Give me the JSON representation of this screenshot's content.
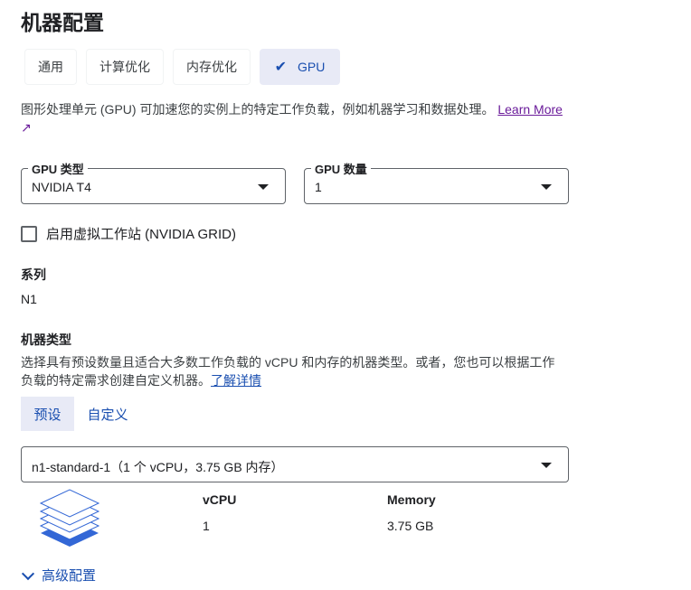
{
  "title": "机器配置",
  "tabs": [
    {
      "label": "通用"
    },
    {
      "label": "计算优化"
    },
    {
      "label": "内存优化"
    },
    {
      "label": "GPU",
      "selected": true
    }
  ],
  "gpu_desc": "图形处理单元 (GPU) 可加速您的实例上的特定工作负载，例如机器学习和数据处理。",
  "learn_more": "Learn More",
  "gpu_type": {
    "label": "GPU 类型",
    "value": "NVIDIA T4"
  },
  "gpu_count": {
    "label": "GPU 数量",
    "value": "1"
  },
  "vws_checkbox": {
    "label": "启用虚拟工作站 (NVIDIA GRID)",
    "checked": false
  },
  "series": {
    "label": "系列",
    "value": "N1"
  },
  "machine_type": {
    "label": "机器类型",
    "desc_line1": "选择具有预设数量且适合大多数工作负载的 vCPU 和内存的机器类型。或者，您也可以根据工作",
    "desc_line2": "负载的特定需求创建自定义机器。",
    "learn_link": "了解详情",
    "tabs": [
      {
        "label": "预设",
        "selected": true
      },
      {
        "label": "自定义"
      }
    ],
    "selected": "n1-standard-1（1 个 vCPU，3.75 GB 内存）",
    "vcpu_label": "vCPU",
    "vcpu_value": "1",
    "memory_label": "Memory",
    "memory_value": "3.75 GB"
  },
  "advanced": "高级配置"
}
